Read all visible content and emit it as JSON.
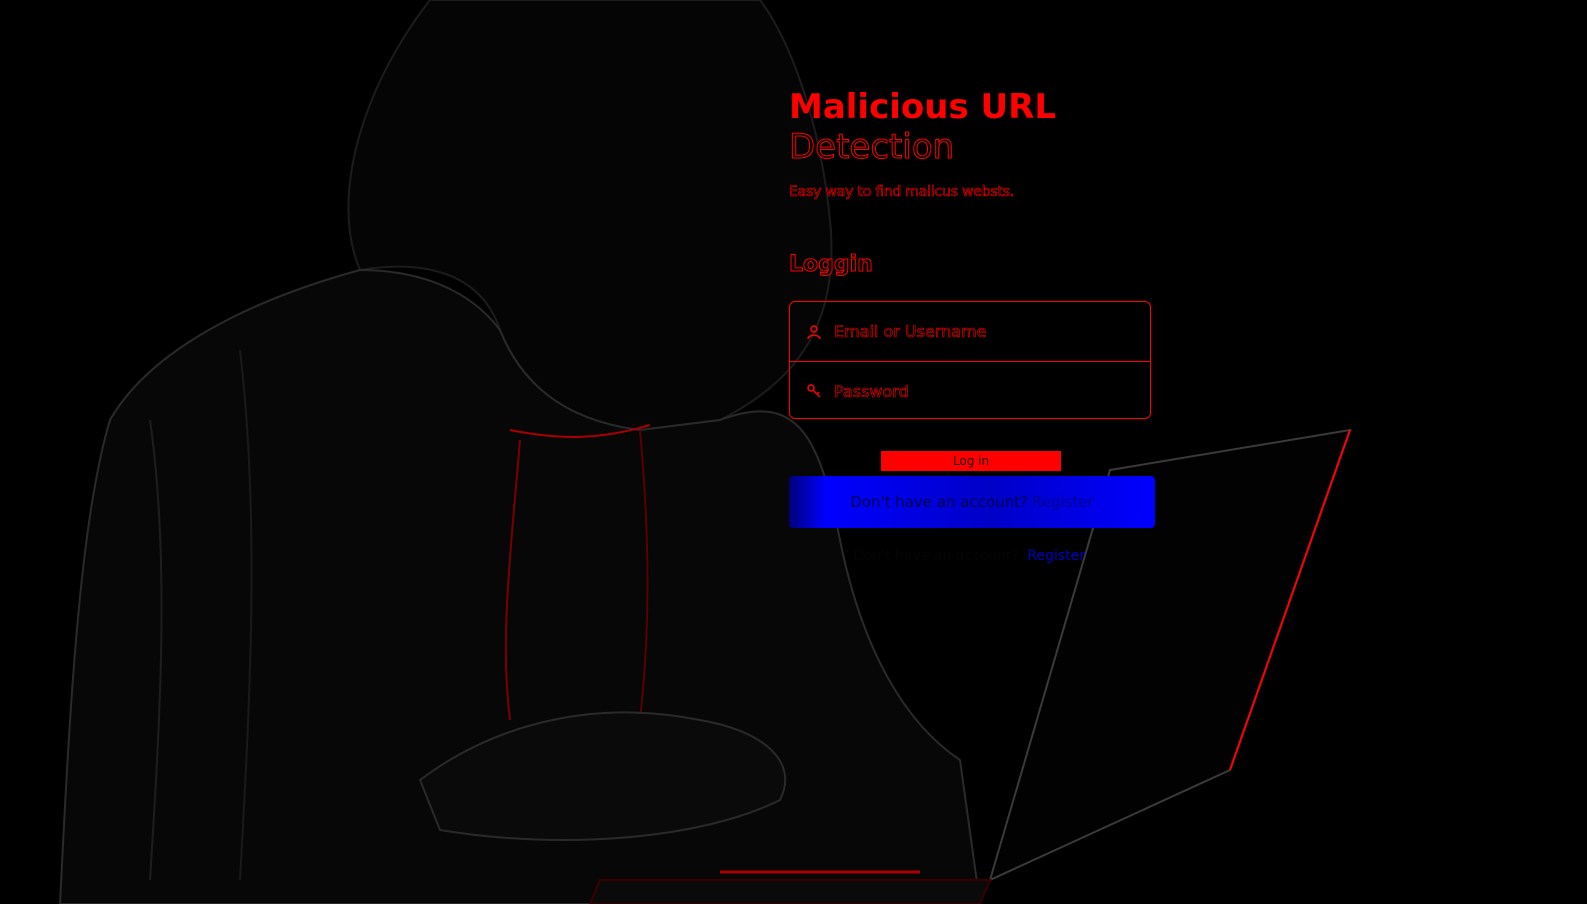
{
  "app": {
    "title_line1": "Malicious URL",
    "title_line2": "Detection",
    "tagline": "Easy way to find malicus websts."
  },
  "login": {
    "heading": "Loggin",
    "username_placeholder": "Email or Username",
    "password_placeholder": "Password",
    "submit_label": "Log in"
  },
  "register": {
    "prompt": "Don't have an account?",
    "link_label": "Register"
  },
  "icons": {
    "username": "user-icon",
    "password": "key-icon"
  },
  "colors": {
    "accent": "#ff0000",
    "banner": "#0000ff",
    "background": "#000000"
  }
}
